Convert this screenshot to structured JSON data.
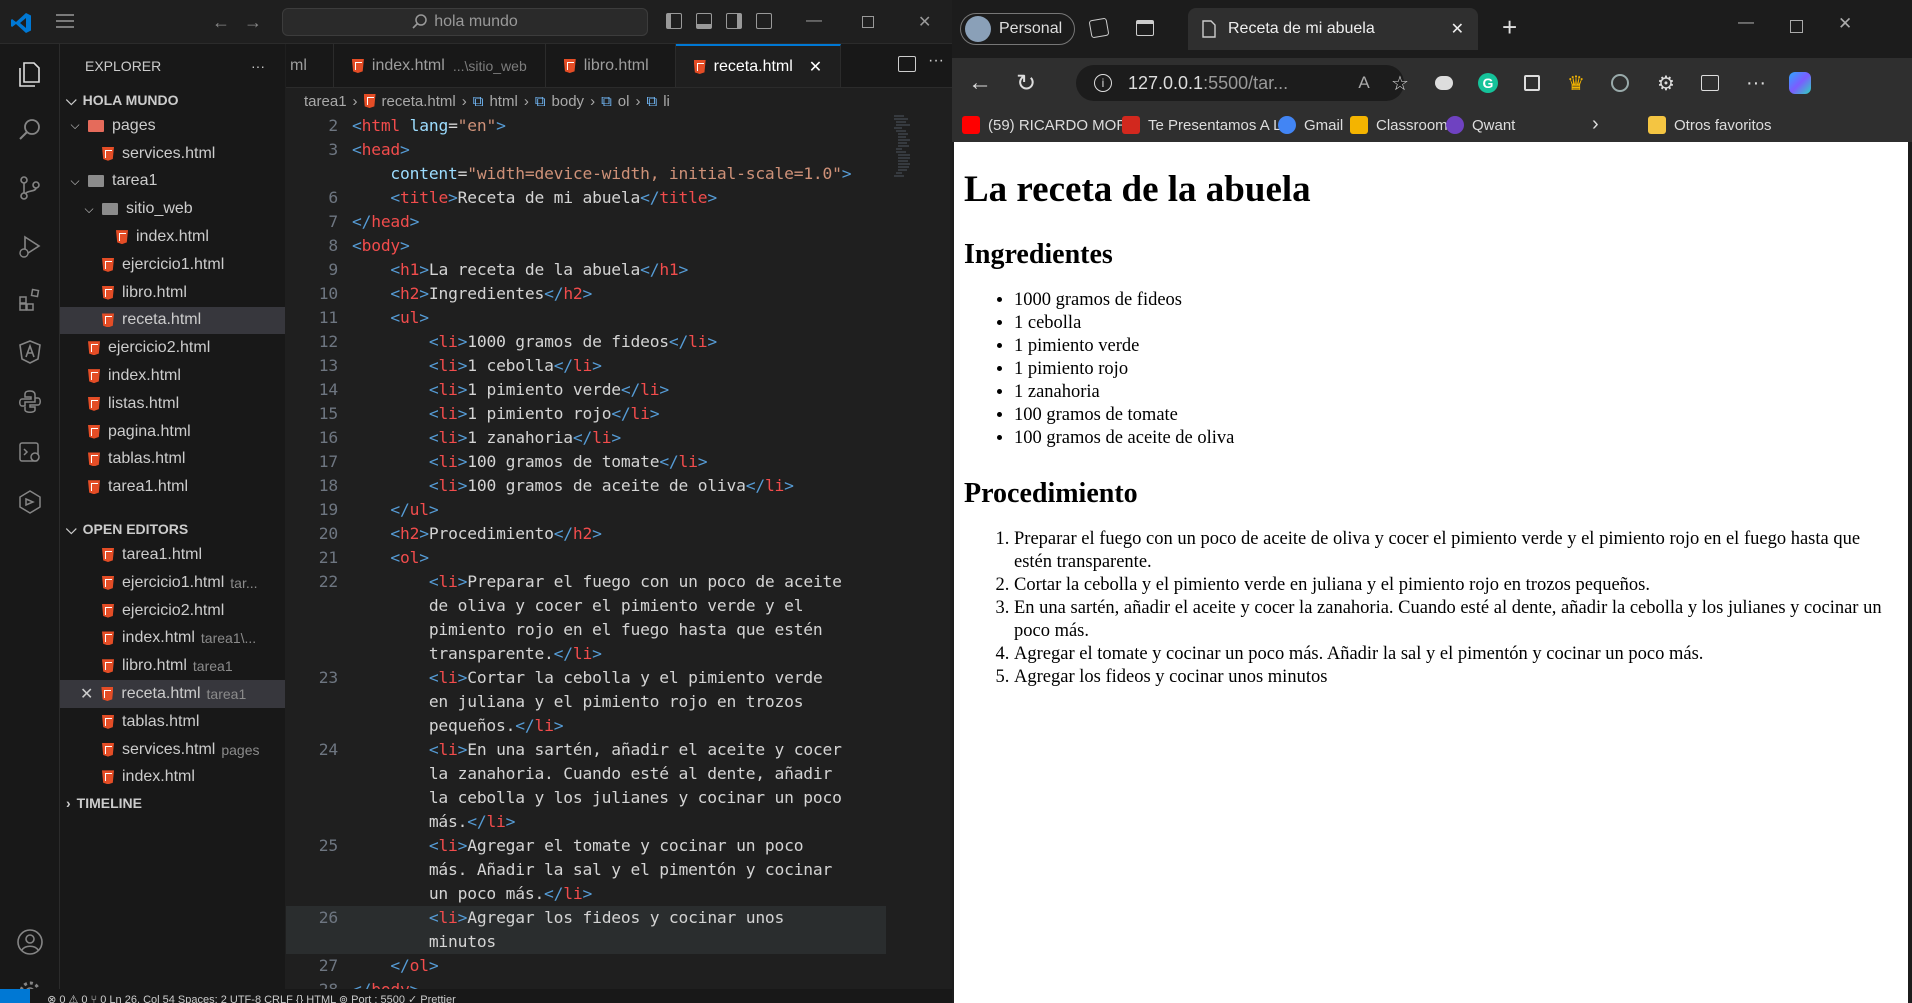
{
  "vscode": {
    "search_text": "hola mundo",
    "explorer_title": "EXPLORER",
    "explorer_more": "···",
    "workspace_name": "HOLA MUNDO",
    "tree": [
      {
        "label": "pages",
        "type": "folder",
        "color": "red",
        "depth": 1,
        "open": true
      },
      {
        "label": "services.html",
        "type": "html",
        "depth": 2
      },
      {
        "label": "tarea1",
        "type": "folder",
        "depth": 1,
        "open": true
      },
      {
        "label": "sitio_web",
        "type": "folder",
        "depth": 2,
        "open": true
      },
      {
        "label": "index.html",
        "type": "html",
        "depth": 3
      },
      {
        "label": "ejercicio1.html",
        "type": "html",
        "depth": 2
      },
      {
        "label": "libro.html",
        "type": "html",
        "depth": 2
      },
      {
        "label": "receta.html",
        "type": "html",
        "depth": 2,
        "selected": true
      },
      {
        "label": "ejercicio2.html",
        "type": "html",
        "depth": 1
      },
      {
        "label": "index.html",
        "type": "html",
        "depth": 1
      },
      {
        "label": "listas.html",
        "type": "html",
        "depth": 1
      },
      {
        "label": "pagina.html",
        "type": "html",
        "depth": 1
      },
      {
        "label": "tablas.html",
        "type": "html",
        "depth": 1
      },
      {
        "label": "tarea1.html",
        "type": "html",
        "depth": 1
      }
    ],
    "open_editors_title": "OPEN EDITORS",
    "open_editors": [
      {
        "label": "tarea1.html",
        "extra": ""
      },
      {
        "label": "ejercicio1.html",
        "extra": "tar..."
      },
      {
        "label": "ejercicio2.html",
        "extra": ""
      },
      {
        "label": "index.html",
        "extra": "tarea1\\..."
      },
      {
        "label": "libro.html",
        "extra": "tarea1"
      },
      {
        "label": "receta.html",
        "extra": "tarea1",
        "selected": true
      },
      {
        "label": "tablas.html",
        "extra": ""
      },
      {
        "label": "services.html",
        "extra": "pages"
      },
      {
        "label": "index.html",
        "extra": ""
      }
    ],
    "timeline_title": "TIMELINE",
    "tabs": [
      {
        "label": "ml",
        "extra": "",
        "partial": true
      },
      {
        "label": "index.html",
        "extra": "...\\sitio_web"
      },
      {
        "label": "libro.html",
        "extra": ""
      },
      {
        "label": "receta.html",
        "extra": "",
        "active": true
      }
    ],
    "breadcrumb": [
      "tarea1",
      "receta.html",
      "html",
      "body",
      "ol",
      "li"
    ],
    "code_lines": [
      {
        "n": "2",
        "t": "<html lang=\"en\">"
      },
      {
        "n": "3",
        "t": "<head>"
      },
      {
        "n": "",
        "t": "    content=\"width=device-width, initial-scale=1.0\">"
      },
      {
        "n": "6",
        "t": "    <title>Receta de mi abuela</title>"
      },
      {
        "n": "7",
        "t": "</head>"
      },
      {
        "n": "8",
        "t": "<body>"
      },
      {
        "n": "9",
        "t": "    <h1>La receta de la abuela</h1>"
      },
      {
        "n": "10",
        "t": "    <h2>Ingredientes</h2>"
      },
      {
        "n": "11",
        "t": "    <ul>"
      },
      {
        "n": "12",
        "t": "        <li>1000 gramos de fideos</li>"
      },
      {
        "n": "13",
        "t": "        <li>1 cebolla</li>"
      },
      {
        "n": "14",
        "t": "        <li>1 pimiento verde</li>"
      },
      {
        "n": "15",
        "t": "        <li>1 pimiento rojo</li>"
      },
      {
        "n": "16",
        "t": "        <li>1 zanahoria</li>"
      },
      {
        "n": "17",
        "t": "        <li>100 gramos de tomate</li>"
      },
      {
        "n": "18",
        "t": "        <li>100 gramos de aceite de oliva</li>"
      },
      {
        "n": "19",
        "t": "    </ul>"
      },
      {
        "n": "20",
        "t": "    <h2>Procedimiento</h2>"
      },
      {
        "n": "21",
        "t": "    <ol>"
      },
      {
        "n": "22",
        "t": "        <li>Preparar el fuego con un poco de aceite"
      },
      {
        "n": "",
        "t": "        de oliva y cocer el pimiento verde y el"
      },
      {
        "n": "",
        "t": "        pimiento rojo en el fuego hasta que estén"
      },
      {
        "n": "",
        "t": "        transparente.</li>"
      },
      {
        "n": "23",
        "t": "        <li>Cortar la cebolla y el pimiento verde"
      },
      {
        "n": "",
        "t": "        en juliana y el pimiento rojo en trozos"
      },
      {
        "n": "",
        "t": "        pequeños.</li>"
      },
      {
        "n": "24",
        "t": "        <li>En una sartén, añadir el aceite y cocer"
      },
      {
        "n": "",
        "t": "        la zanahoria. Cuando esté al dente, añadir"
      },
      {
        "n": "",
        "t": "        la cebolla y los julianes y cocinar un poco"
      },
      {
        "n": "",
        "t": "        más.</li>"
      },
      {
        "n": "25",
        "t": "        <li>Agregar el tomate y cocinar un poco"
      },
      {
        "n": "",
        "t": "        más. Añadir la sal y el pimentón y cocinar"
      },
      {
        "n": "",
        "t": "        un poco más.</li>"
      },
      {
        "n": "26",
        "t": "        <li>Agregar los fideos y cocinar unos",
        "cur": true
      },
      {
        "n": "",
        "t": "        minutos",
        "cur": true
      },
      {
        "n": "27",
        "t": "    </ol>"
      },
      {
        "n": "28",
        "t": "</body>"
      }
    ],
    "status": "⊗ 0 ⚠ 0    ⑂ 0    Ln 26, Col 54    Spaces: 2    UTF-8    CRLF    {} HTML    ⊚ Port : 5500    ✓ Prettier"
  },
  "browser": {
    "profile": "Personal",
    "tab_title": "Receta de mi abuela",
    "url_host": "127.0.0.1",
    "url_rest": ":5500/tar...",
    "favorites": [
      {
        "label": "(59) RICARDO MOR...",
        "color": "#ff0000"
      },
      {
        "label": "Te Presentamos A L...",
        "color": "#d2281e"
      },
      {
        "label": "Gmail",
        "color": "#4285f4"
      },
      {
        "label": "Classroom",
        "color": "#f4b400"
      },
      {
        "label": "Qwant",
        "color": "#6f42c1"
      }
    ],
    "other_favorites": "Otros favoritos",
    "page": {
      "h1": "La receta de la abuela",
      "h2_ingredients": "Ingredientes",
      "ingredients": [
        "1000 gramos de fideos",
        "1 cebolla",
        "1 pimiento verde",
        "1 pimiento rojo",
        "1 zanahoria",
        "100 gramos de tomate",
        "100 gramos de aceite de oliva"
      ],
      "h2_procedure": "Procedimiento",
      "steps": [
        "Preparar el fuego con un poco de aceite de oliva y cocer el pimiento verde y el pimiento rojo en el fuego hasta que estén transparente.",
        "Cortar la cebolla y el pimiento verde en juliana y el pimiento rojo en trozos pequeños.",
        "En una sartén, añadir el aceite y cocer la zanahoria. Cuando esté al dente, añadir la cebolla y los julianes y cocinar un poco más.",
        "Agregar el tomate y cocinar un poco más. Añadir la sal y el pimentón y cocinar un poco más.",
        "Agregar los fideos y cocinar unos minutos"
      ]
    }
  }
}
